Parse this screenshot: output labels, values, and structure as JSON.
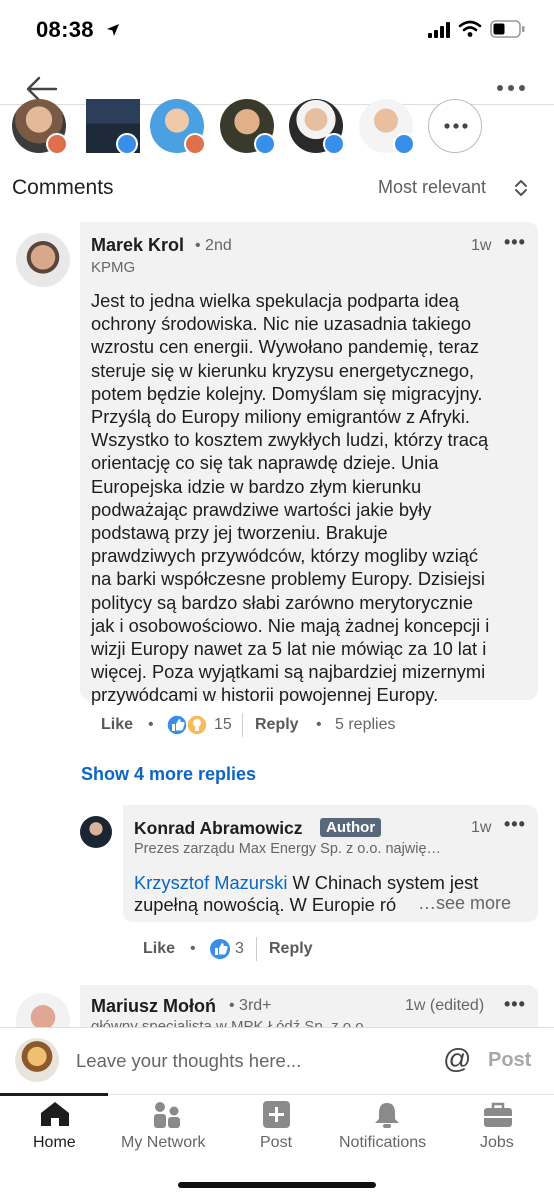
{
  "status_bar": {
    "time": "08:38"
  },
  "comments_header": {
    "title": "Comments",
    "sort": "Most relevant"
  },
  "comment1": {
    "name": "Marek Krol",
    "degree": "• 2nd",
    "headline": "KPMG",
    "time": "1w",
    "lines": [
      "Jest to jedna wielka spekulacja podparta ideą",
      "ochrony środowiska. Nic nie uzasadnia takiego",
      "wzrostu cen energii. Wywołano pandemię, teraz",
      "steruje się w kierunku kryzysu energetycznego,",
      "potem będzie kolejny. Domyślam się migracyjny.",
      "Przyślą do Europy miliony emigrantów z Afryki.",
      "Wszystko to kosztem zwykłych ludzi, którzy tracą",
      "orientację co się tak naprawdę dzieje. Unia",
      "Europejska idzie w bardzo złym kierunku",
      "podważając prawdziwe wartości jakie były",
      "podstawą przy jej tworzeniu. Brakuje",
      "prawdziwych przywódców, którzy mogliby wziąć",
      "na barki współczesne problemy Europy. Dzisiejsi",
      "politycy są bardzo słabi zarówno merytorycznie",
      "jak i osobowościowo. Nie mają żadnej koncepcji i",
      "wizji Europy nawet za 5 lat nie mówiąc za 10 lat i",
      "więcej. Poza wyjątkami są najbardziej mizernymi",
      "przywódcami w historii powojennej Europy."
    ],
    "like_label": "Like",
    "reaction_count": "15",
    "reply_label": "Reply",
    "replies_count": "5 replies"
  },
  "show_more": "Show 4 more replies",
  "reply1": {
    "name": "Konrad Abramowicz",
    "author_badge": "Author",
    "time": "1w",
    "headline": "Prezes zarządu Max Energy Sp. z o.o. najwię…",
    "mention": "Krzysztof Mazurski",
    "line1_rest": " W Chinach system jest",
    "line2": "zupełną nowością. W Europie ró",
    "see_more": "…see more",
    "like_label": "Like",
    "reaction_count": "3",
    "reply_label": "Reply"
  },
  "comment2": {
    "name": "Mariusz Mołoń",
    "degree": "• 3rd+",
    "time": "1w (edited)",
    "headline": "główny specjalista w MPK Łódź Sp. z o.o."
  },
  "input_bar": {
    "placeholder": "Leave your thoughts here...",
    "at_symbol": "@",
    "post": "Post"
  },
  "tabs": [
    {
      "label": "Home",
      "icon": "home-icon"
    },
    {
      "label": "My Network",
      "icon": "network-icon"
    },
    {
      "label": "Post",
      "icon": "plus-icon"
    },
    {
      "label": "Notifications",
      "icon": "bell-icon"
    },
    {
      "label": "Jobs",
      "icon": "briefcase-icon"
    }
  ],
  "colors": {
    "link": "#0a66c2",
    "like_badge": "#378fe9",
    "author_badge": "#56687a",
    "active_tab": "#1d1d1d"
  }
}
